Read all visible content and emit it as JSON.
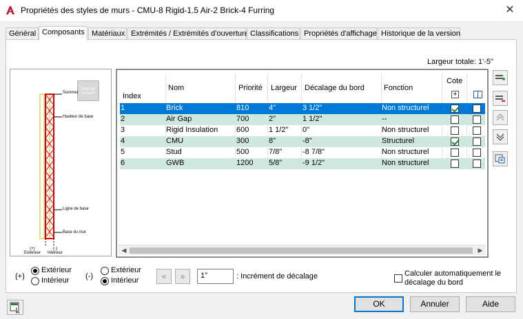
{
  "window": {
    "title": "Propriétés des styles de murs - CMU-8 Rigid-1.5 Air-2 Brick-4 Furring",
    "app_icon": "autocad-a-icon",
    "close": "✕"
  },
  "tabs": [
    {
      "label": "Général",
      "active": false
    },
    {
      "label": "Composants",
      "active": true
    },
    {
      "label": "Matériaux",
      "active": false
    },
    {
      "label": "Extrémités / Extrémités d'ouverture",
      "active": false
    },
    {
      "label": "Classifications",
      "active": false
    },
    {
      "label": "Propriétés d'affichage",
      "active": false
    },
    {
      "label": "Historique de la version",
      "active": false
    }
  ],
  "total_width_label": "Largeur totale: 1'-5\"",
  "preview": {
    "side_button": "GAUCHE\nDU MUR",
    "labels": {
      "top": "Sommet",
      "base_height": "Hauteur de base",
      "baseline": "Ligne de base",
      "wall_base": "Base du mur",
      "ext": "(+)\nExtérieur",
      "int": "(-)\nIntérieur"
    }
  },
  "grid": {
    "headers": {
      "index": "Index",
      "name": "Nom",
      "priority": "Priorité",
      "width": "Largeur",
      "offset": "Décalage du bord",
      "function": "Fonction",
      "dimension": "Cote"
    },
    "rows": [
      {
        "index": "1",
        "name": "Brick",
        "priority": "810",
        "width": "4\"",
        "offset": "3 1/2\"",
        "function": "Non structurel",
        "dim": true,
        "dim2": false,
        "style": "selected"
      },
      {
        "index": "2",
        "name": "Air Gap",
        "priority": "700",
        "width": "2\"",
        "offset": "1 1/2\"",
        "function": "--",
        "dim": false,
        "dim2": false,
        "style": "alt"
      },
      {
        "index": "3",
        "name": "Rigid Insulation",
        "priority": "600",
        "width": "1 1/2\"",
        "offset": "0\"",
        "function": "Non structurel",
        "dim": false,
        "dim2": false,
        "style": "plain"
      },
      {
        "index": "4",
        "name": "CMU",
        "priority": "300",
        "width": "8\"",
        "offset": "-8\"",
        "function": "Structurel",
        "dim": true,
        "dim2": false,
        "style": "alt"
      },
      {
        "index": "5",
        "name": "Stud",
        "priority": "500",
        "width": "7/8\"",
        "offset": "-8 7/8\"",
        "function": "Non structurel",
        "dim": false,
        "dim2": false,
        "style": "plain"
      },
      {
        "index": "6",
        "name": "GWB",
        "priority": "1200",
        "width": "5/8\"",
        "offset": "-9 1/2\"",
        "function": "Non structurel",
        "dim": false,
        "dim2": false,
        "style": "alt"
      }
    ]
  },
  "controls": {
    "plus_label": "(+)",
    "minus_label": "(-)",
    "plus_options": {
      "exterior": "Extérieur",
      "interior": "Intérieur",
      "selected": "exterior"
    },
    "minus_options": {
      "exterior": "Extérieur",
      "interior": "Intérieur",
      "selected": "interior"
    },
    "increment_value": "1\"",
    "increment_label": ": Incrément de décalage",
    "auto_calc_label_1": "Calculer automatiquement le",
    "auto_calc_label_2": "décalage du bord",
    "auto_calc_checked": false
  },
  "buttons": {
    "ok": "OK",
    "cancel": "Annuler",
    "help": "Aide"
  },
  "colors": {
    "selection": "#0078d7",
    "alt_row": "#cfe8df",
    "accent": "#0078d7"
  }
}
